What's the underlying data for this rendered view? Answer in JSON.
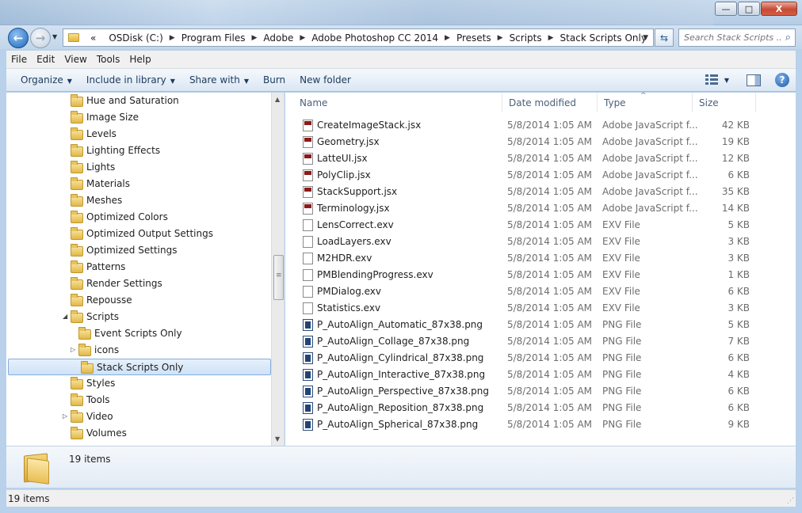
{
  "window": {
    "minimize": "—",
    "maximize": "□",
    "close": "X"
  },
  "address": {
    "overflow": "«",
    "crumbs": [
      "OSDisk (C:)",
      "Program Files",
      "Adobe",
      "Adobe Photoshop CC 2014",
      "Presets",
      "Scripts",
      "Stack Scripts Only"
    ],
    "search_placeholder": "Search Stack Scripts ..."
  },
  "menu": [
    "File",
    "Edit",
    "View",
    "Tools",
    "Help"
  ],
  "commands": {
    "organize": "Organize",
    "include": "Include in library",
    "share": "Share with",
    "burn": "Burn",
    "new_folder": "New folder"
  },
  "tree": [
    {
      "label": "Hue and Saturation",
      "indent": 1,
      "expander": ""
    },
    {
      "label": "Image Size",
      "indent": 1,
      "expander": ""
    },
    {
      "label": "Levels",
      "indent": 1,
      "expander": ""
    },
    {
      "label": "Lighting Effects",
      "indent": 1,
      "expander": ""
    },
    {
      "label": "Lights",
      "indent": 1,
      "expander": ""
    },
    {
      "label": "Materials",
      "indent": 1,
      "expander": ""
    },
    {
      "label": "Meshes",
      "indent": 1,
      "expander": ""
    },
    {
      "label": "Optimized Colors",
      "indent": 1,
      "expander": ""
    },
    {
      "label": "Optimized Output Settings",
      "indent": 1,
      "expander": ""
    },
    {
      "label": "Optimized Settings",
      "indent": 1,
      "expander": ""
    },
    {
      "label": "Patterns",
      "indent": 1,
      "expander": ""
    },
    {
      "label": "Render Settings",
      "indent": 1,
      "expander": ""
    },
    {
      "label": "Repousse",
      "indent": 1,
      "expander": ""
    },
    {
      "label": "Scripts",
      "indent": 1,
      "expander": "◢"
    },
    {
      "label": "Event Scripts Only",
      "indent": 2,
      "expander": ""
    },
    {
      "label": "icons",
      "indent": 2,
      "expander": "▷"
    },
    {
      "label": "Stack Scripts Only",
      "indent": 2,
      "expander": "",
      "selected": true
    },
    {
      "label": "Styles",
      "indent": 1,
      "expander": ""
    },
    {
      "label": "Tools",
      "indent": 1,
      "expander": ""
    },
    {
      "label": "Video",
      "indent": 1,
      "expander": "▷"
    },
    {
      "label": "Volumes",
      "indent": 1,
      "expander": ""
    }
  ],
  "columns": {
    "name": "Name",
    "date": "Date modified",
    "type": "Type",
    "size": "Size"
  },
  "files": [
    {
      "name": "CreateImageStack.jsx",
      "date": "5/8/2014 1:05 AM",
      "type": "Adobe JavaScript f...",
      "size": "42 KB",
      "icon": "jsx"
    },
    {
      "name": "Geometry.jsx",
      "date": "5/8/2014 1:05 AM",
      "type": "Adobe JavaScript f...",
      "size": "19 KB",
      "icon": "jsx"
    },
    {
      "name": "LatteUI.jsx",
      "date": "5/8/2014 1:05 AM",
      "type": "Adobe JavaScript f...",
      "size": "12 KB",
      "icon": "jsx"
    },
    {
      "name": "PolyClip.jsx",
      "date": "5/8/2014 1:05 AM",
      "type": "Adobe JavaScript f...",
      "size": "6 KB",
      "icon": "jsx"
    },
    {
      "name": "StackSupport.jsx",
      "date": "5/8/2014 1:05 AM",
      "type": "Adobe JavaScript f...",
      "size": "35 KB",
      "icon": "jsx"
    },
    {
      "name": "Terminology.jsx",
      "date": "5/8/2014 1:05 AM",
      "type": "Adobe JavaScript f...",
      "size": "14 KB",
      "icon": "jsx"
    },
    {
      "name": "LensCorrect.exv",
      "date": "5/8/2014 1:05 AM",
      "type": "EXV File",
      "size": "5 KB",
      "icon": "exv"
    },
    {
      "name": "LoadLayers.exv",
      "date": "5/8/2014 1:05 AM",
      "type": "EXV File",
      "size": "3 KB",
      "icon": "exv"
    },
    {
      "name": "M2HDR.exv",
      "date": "5/8/2014 1:05 AM",
      "type": "EXV File",
      "size": "3 KB",
      "icon": "exv"
    },
    {
      "name": "PMBlendingProgress.exv",
      "date": "5/8/2014 1:05 AM",
      "type": "EXV File",
      "size": "1 KB",
      "icon": "exv"
    },
    {
      "name": "PMDialog.exv",
      "date": "5/8/2014 1:05 AM",
      "type": "EXV File",
      "size": "6 KB",
      "icon": "exv"
    },
    {
      "name": "Statistics.exv",
      "date": "5/8/2014 1:05 AM",
      "type": "EXV File",
      "size": "3 KB",
      "icon": "exv"
    },
    {
      "name": "P_AutoAlign_Automatic_87x38.png",
      "date": "5/8/2014 1:05 AM",
      "type": "PNG File",
      "size": "5 KB",
      "icon": "png"
    },
    {
      "name": "P_AutoAlign_Collage_87x38.png",
      "date": "5/8/2014 1:05 AM",
      "type": "PNG File",
      "size": "7 KB",
      "icon": "png"
    },
    {
      "name": "P_AutoAlign_Cylindrical_87x38.png",
      "date": "5/8/2014 1:05 AM",
      "type": "PNG File",
      "size": "6 KB",
      "icon": "png"
    },
    {
      "name": "P_AutoAlign_Interactive_87x38.png",
      "date": "5/8/2014 1:05 AM",
      "type": "PNG File",
      "size": "4 KB",
      "icon": "png"
    },
    {
      "name": "P_AutoAlign_Perspective_87x38.png",
      "date": "5/8/2014 1:05 AM",
      "type": "PNG File",
      "size": "6 KB",
      "icon": "png"
    },
    {
      "name": "P_AutoAlign_Reposition_87x38.png",
      "date": "5/8/2014 1:05 AM",
      "type": "PNG File",
      "size": "6 KB",
      "icon": "png"
    },
    {
      "name": "P_AutoAlign_Spherical_87x38.png",
      "date": "5/8/2014 1:05 AM",
      "type": "PNG File",
      "size": "9 KB",
      "icon": "png"
    }
  ],
  "details": {
    "count": "19 items"
  },
  "status": {
    "count": "19 items"
  }
}
